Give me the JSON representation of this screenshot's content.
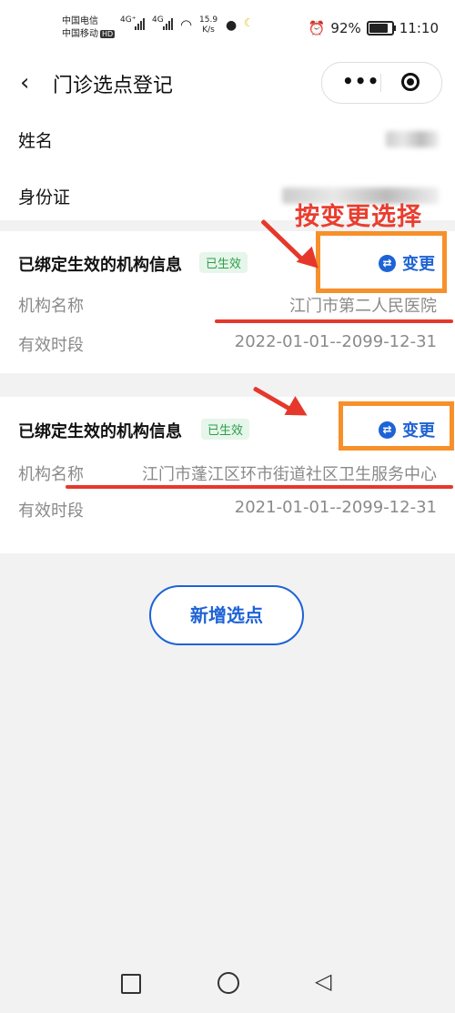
{
  "status_bar": {
    "carrier1": "中国电信",
    "carrier2": "中国移动",
    "hd": "HD",
    "net1": "4G⁺",
    "net2": "4G",
    "speed_value": "15.9",
    "speed_unit": "K/s",
    "battery": "92%",
    "time": "11:10"
  },
  "nav": {
    "title": "门诊选点登记",
    "back_icon": "‹",
    "more_icon": "•••"
  },
  "personal": {
    "name_label": "姓名",
    "id_label": "身份证"
  },
  "annotation": "按变更选择",
  "institutions": [
    {
      "title": "已绑定生效的机构信息",
      "badge": "已生效",
      "change_label": "变更",
      "name_label": "机构名称",
      "name_value": "江门市第二人民医院",
      "period_label": "有效时段",
      "period_value": "2022-01-01--2099-12-31"
    },
    {
      "title": "已绑定生效的机构信息",
      "badge": "已生效",
      "change_label": "变更",
      "name_label": "机构名称",
      "name_value": "江门市蓬江区环市街道社区卫生服务中心",
      "period_label": "有效时段",
      "period_value": "2021-01-01--2099-12-31"
    }
  ],
  "add_button": "新增选点",
  "colors": {
    "accent": "#1e63d6",
    "annotation_red": "#ea3d2f",
    "highlight_orange": "#f7902a",
    "badge_green": "#2e9d4a"
  }
}
